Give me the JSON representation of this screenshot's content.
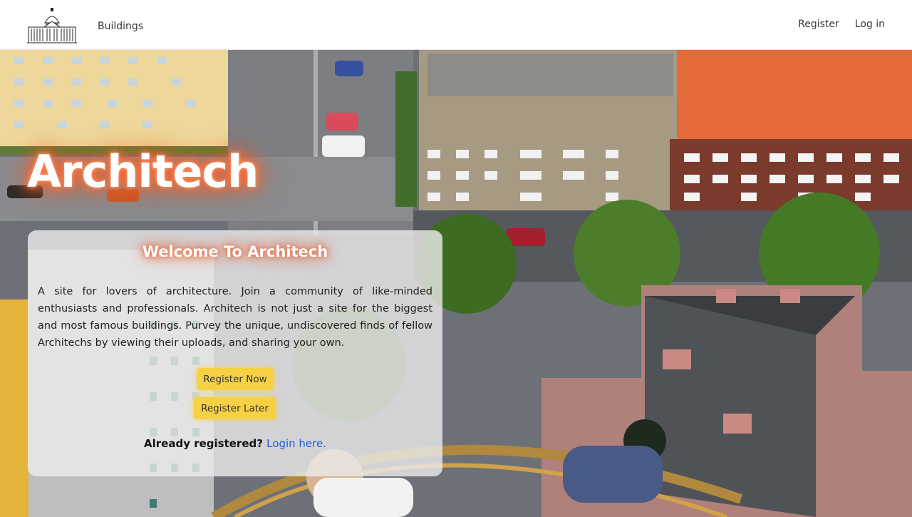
{
  "nav": {
    "buildings": "Buildings",
    "register": "Register",
    "login": "Log in"
  },
  "hero": {
    "brand": "Architech"
  },
  "card": {
    "title": "Welcome To Architech",
    "text": "A site for lovers of architecture. Join a community of like-minded enthusiasts and professionals. Architech is not just a site for the biggest and most famous buildings. Purvey the unique, undiscovered finds of fellow Architechs by viewing their uploads, and sharing your own.",
    "register_now": "Register Now",
    "register_later": "Register Later",
    "login_prompt": "Already registered?",
    "login_link": "Login here."
  },
  "colors": {
    "button": "#f6d143",
    "link": "#1f5fd6",
    "glow": "#ff5a22"
  }
}
